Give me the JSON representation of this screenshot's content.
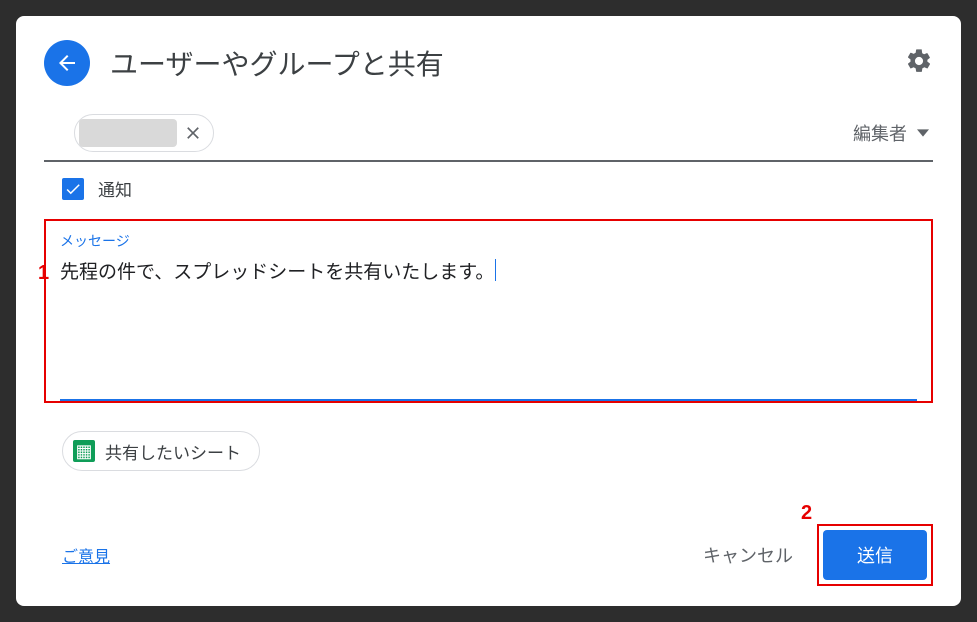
{
  "header": {
    "title": "ユーザーやグループと共有"
  },
  "recipients": {
    "role_label": "編集者"
  },
  "notify": {
    "label": "通知",
    "checked": true
  },
  "message": {
    "label": "メッセージ",
    "text": "先程の件で、スプレッドシートを共有いたします。"
  },
  "attachment": {
    "name": "共有したいシート"
  },
  "footer": {
    "feedback": "ご意見",
    "cancel": "キャンセル",
    "send": "送信"
  },
  "annotations": {
    "one": "1",
    "two": "2"
  }
}
